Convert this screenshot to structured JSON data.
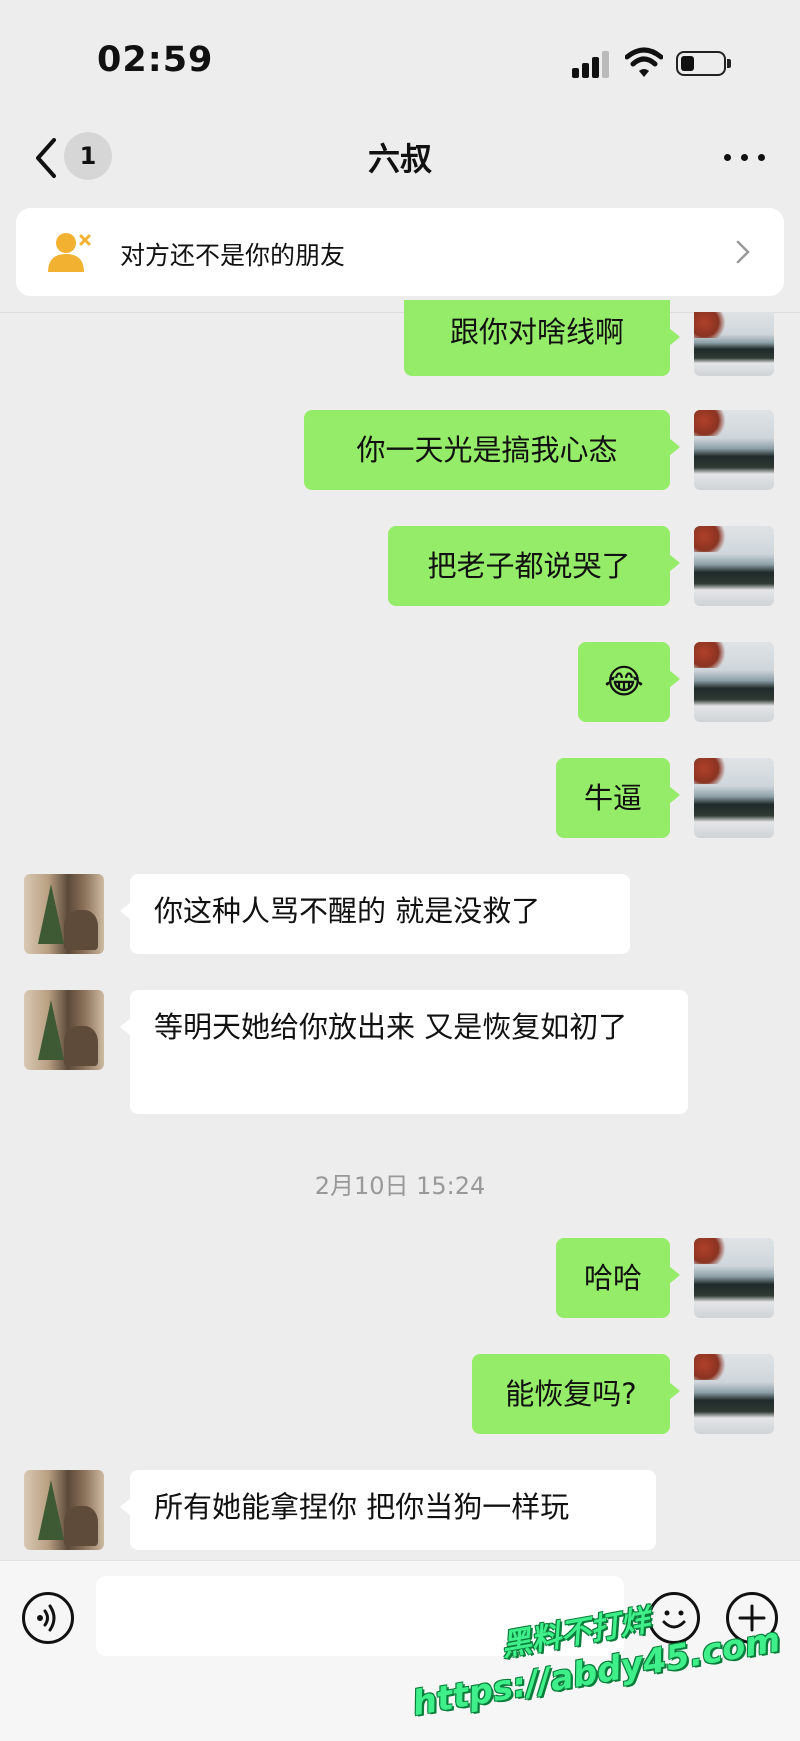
{
  "status_bar": {
    "time": "02:59"
  },
  "nav": {
    "unread_count": "1",
    "title": "六叔"
  },
  "notice": {
    "text": "对方还不是你的朋友"
  },
  "messages": [
    {
      "side": "me",
      "text": "跟你对啥线啊"
    },
    {
      "side": "me",
      "text": "你一天光是搞我心态"
    },
    {
      "side": "me",
      "text": "把老子都说哭了"
    },
    {
      "side": "me",
      "text": "😂"
    },
    {
      "side": "me",
      "text": "牛逼"
    },
    {
      "side": "them",
      "text": "你这种人骂不醒的 就是没救了"
    },
    {
      "side": "them",
      "text": "等明天她给你放出来 又是恢复如初了"
    },
    {
      "side": "me",
      "text": "哈哈"
    },
    {
      "side": "me",
      "text": "能恢复吗?"
    },
    {
      "side": "them",
      "text": "所有她能拿捏你 把你当狗一样玩"
    }
  ],
  "timestamp": "2月10日 15:24",
  "input_bar": {
    "value": "",
    "icons": [
      "voice-icon",
      "emoji-icon",
      "plus-icon"
    ]
  },
  "watermark": {
    "line1": "黑料不打烊",
    "line2": "https://abdy45.com"
  },
  "colors": {
    "my_bubble": "#95ec69",
    "their_bubble": "#ffffff",
    "background": "#ededed"
  }
}
